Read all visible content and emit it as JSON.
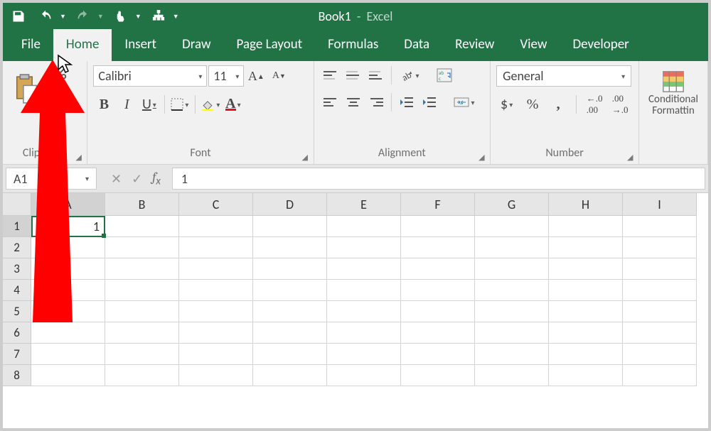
{
  "app": {
    "title_doc": "Book1",
    "title_app": "Excel"
  },
  "tabs": {
    "file": "File",
    "home": "Home",
    "insert": "Insert",
    "draw": "Draw",
    "page_layout": "Page Layout",
    "formulas": "Formulas",
    "data": "Data",
    "review": "Review",
    "view": "View",
    "developer": "Developer"
  },
  "ribbon": {
    "clipboard": {
      "label": "Clipboard"
    },
    "font": {
      "label": "Font",
      "name": "Calibri",
      "size": "11",
      "bold": "B",
      "italic": "I",
      "underline": "U"
    },
    "alignment": {
      "label": "Alignment"
    },
    "number": {
      "label": "Number",
      "format": "General",
      "currency": "$",
      "percent": "%",
      "comma": ","
    },
    "styles": {
      "conditional": "Conditional Formatting"
    }
  },
  "namebox": "A1",
  "formula_bar": "1",
  "grid": {
    "columns": [
      "A",
      "B",
      "C",
      "D",
      "E",
      "F",
      "G",
      "H",
      "I"
    ],
    "rows": [
      "1",
      "2",
      "3",
      "4",
      "5",
      "6",
      "7",
      "8"
    ],
    "active_value": "1"
  }
}
